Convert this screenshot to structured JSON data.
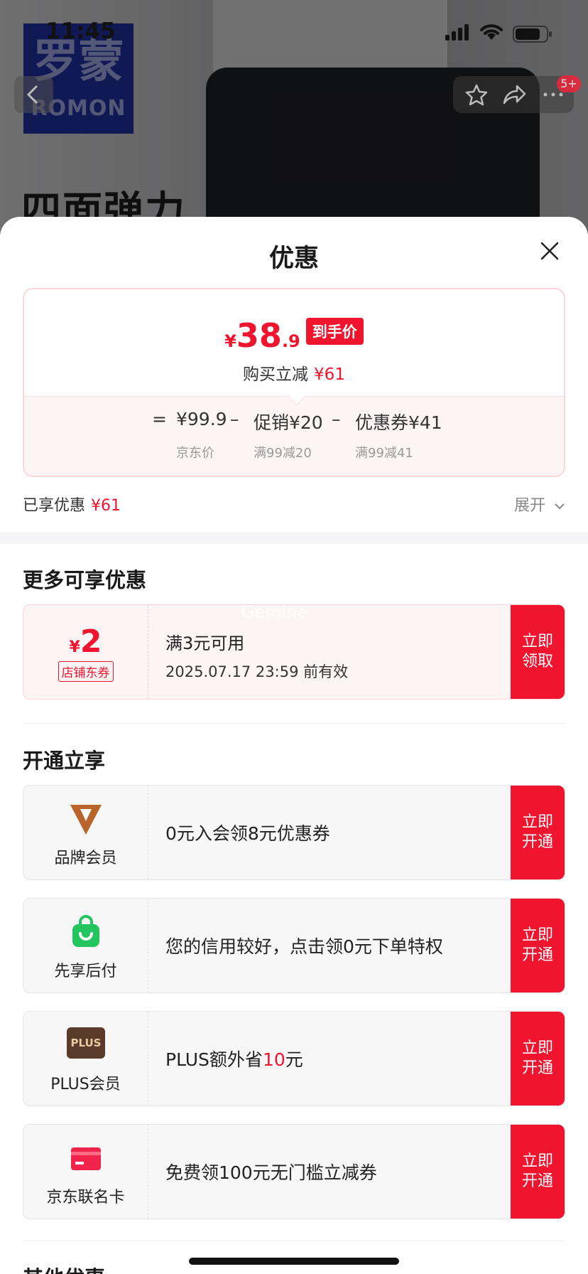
{
  "status_bar": {
    "time": "11:45"
  },
  "background": {
    "logo_cn": "罗蒙",
    "logo_en": "ROMON",
    "headline": "四面弹力",
    "cart_badge": "5+"
  },
  "sheet": {
    "title": "优惠",
    "price": {
      "yen": "¥",
      "integer": "38",
      "decimal": ".9",
      "tag": "到手价",
      "reduce_label": "购买立减",
      "reduce_value": "¥61"
    },
    "formula": {
      "eq": "=",
      "jd_price": "¥99.9",
      "jd_label": "京东价",
      "minus1": "–",
      "promo": "促销¥20",
      "promo_sub": "满99减20",
      "minus2": "–",
      "coupon": "优惠券¥41",
      "coupon_sub": "满99减41"
    },
    "enjoyed_label": "已享优惠",
    "enjoyed_value": "¥61",
    "expand_label": "展开"
  },
  "more_offers": {
    "title": "更多可享优惠",
    "coupon": {
      "yen": "¥",
      "amount": "2",
      "tag": "店铺东券",
      "condition": "满3元可用",
      "validity": "2025.07.17 23:59 前有效",
      "cta": "立即领取"
    },
    "watermark": "Gemine"
  },
  "open_enjoy": {
    "title": "开通立享",
    "items": [
      {
        "name": "品牌会员",
        "icon": "brand-v-icon",
        "desc": "0元入会领8元优惠券",
        "cta": "立即开通"
      },
      {
        "name": "先享后付",
        "icon": "shopping-bag-icon",
        "desc": "您的信用较好，点击领0元下单特权",
        "cta": "立即开通"
      },
      {
        "name": "PLUS会员",
        "icon": "plus-badge-icon",
        "badge_text": "PLUS",
        "desc_prefix": "PLUS额外省",
        "desc_highlight": "10",
        "desc_suffix": "元",
        "cta": "立即开通"
      },
      {
        "name": "京东联名卡",
        "icon": "credit-card-icon",
        "desc": "免费领100元无门槛立减券",
        "cta": "立即开通"
      }
    ]
  },
  "other_offers": {
    "title": "其他优惠"
  },
  "colors": {
    "accent": "#f0142f",
    "brand_v": "#b8642a",
    "bag_green": "#22c55e",
    "plus_brown": "#5a3b2a",
    "card_red": "#f0244a"
  }
}
